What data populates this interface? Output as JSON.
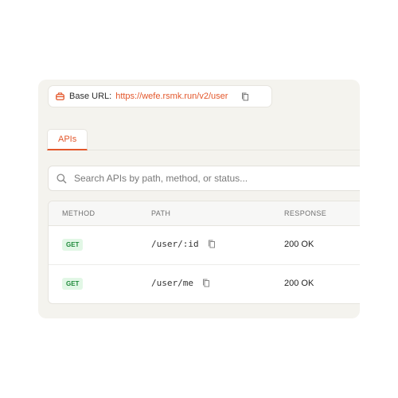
{
  "base_url": {
    "label": "Base URL:",
    "value": "https://wefe.rsmk.run/v2/user",
    "icon": "server-icon",
    "copy_icon": "copy-icon"
  },
  "tabs": [
    {
      "label": "APIs",
      "active": true
    }
  ],
  "search": {
    "placeholder": "Search APIs by path, method, or status..."
  },
  "table": {
    "columns": [
      "METHOD",
      "PATH",
      "RESPONSE"
    ],
    "rows": [
      {
        "method": "GET",
        "path": "/user/:id",
        "response": "200 OK"
      },
      {
        "method": "GET",
        "path": "/user/me",
        "response": "200 OK"
      }
    ]
  },
  "colors": {
    "accent": "#e3572b",
    "get_badge_bg": "#e2f7e6",
    "get_badge_text": "#1f8a3b"
  }
}
